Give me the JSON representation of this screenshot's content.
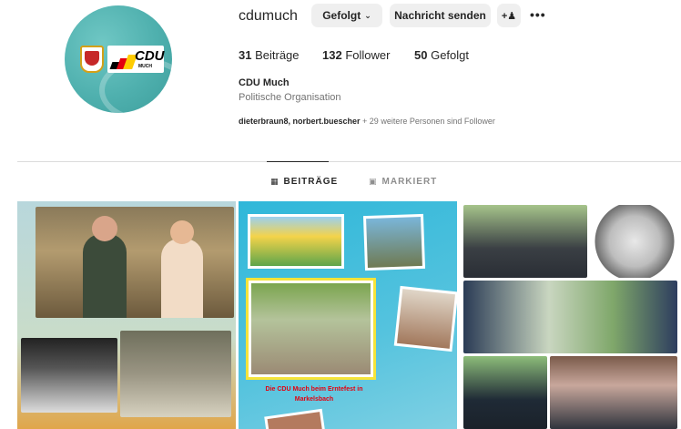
{
  "profile": {
    "username": "cdumuch",
    "follow_button": "Gefolgt",
    "message_button": "Nachricht senden",
    "suggest_icon": "add-person-icon",
    "more_icon": "more-dots-icon",
    "avatar_brand": "CDU",
    "avatar_sub": "MUCH"
  },
  "stats": {
    "posts_count": "31",
    "posts_label": "Beiträge",
    "followers_count": "132",
    "followers_label": "Follower",
    "following_count": "50",
    "following_label": "Gefolgt"
  },
  "bio": {
    "full_name": "CDU Much",
    "category": "Politische Organisation",
    "followed_by_names": "dieterbraun8, norbert.buescher",
    "followed_by_rest": " + 29 weitere Personen sind Follower"
  },
  "tabs": [
    {
      "label": "BEITRÄGE",
      "icon": "grid-icon",
      "active": true
    },
    {
      "label": "MARKIERT",
      "icon": "tagged-icon",
      "active": false
    }
  ],
  "posts": {
    "post2_caption": "Die CDU Much beim Erntefest in Markelsbach"
  }
}
